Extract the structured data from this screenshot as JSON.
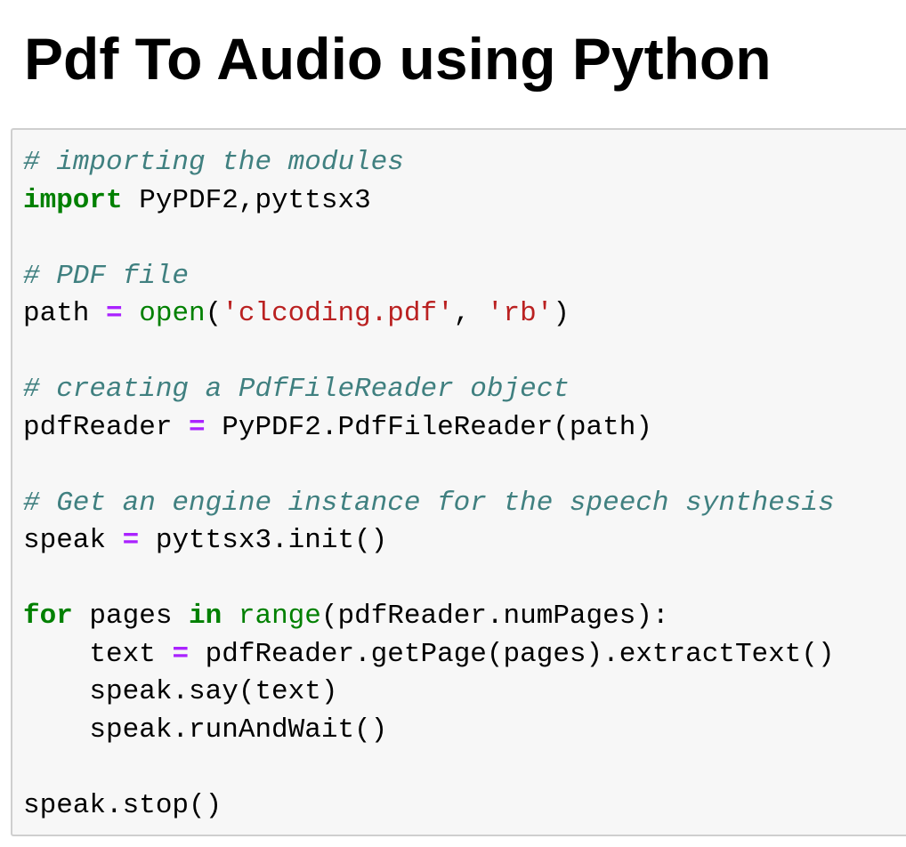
{
  "page": {
    "title": "Pdf To Audio using Python"
  },
  "colors": {
    "comment": "#408080",
    "keyword": "#008000",
    "builtin": "#008000",
    "operator": "#aa22ff",
    "string": "#ba2121",
    "text": "#000000",
    "cell_background": "#f7f7f7",
    "cell_border": "#cfcfcf"
  },
  "code": {
    "language": "python",
    "lines": [
      [
        {
          "type": "comment",
          "text": "# importing the modules"
        }
      ],
      [
        {
          "type": "keyword",
          "text": "import"
        },
        {
          "type": "plain",
          "text": " PyPDF2,pyttsx3"
        }
      ],
      [],
      [
        {
          "type": "comment",
          "text": "# PDF file"
        }
      ],
      [
        {
          "type": "plain",
          "text": "path "
        },
        {
          "type": "operator",
          "text": "="
        },
        {
          "type": "plain",
          "text": " "
        },
        {
          "type": "builtin",
          "text": "open"
        },
        {
          "type": "plain",
          "text": "("
        },
        {
          "type": "string",
          "text": "'clcoding.pdf'"
        },
        {
          "type": "plain",
          "text": ", "
        },
        {
          "type": "string",
          "text": "'rb'"
        },
        {
          "type": "plain",
          "text": ")"
        }
      ],
      [],
      [
        {
          "type": "comment",
          "text": "# creating a PdfFileReader object"
        }
      ],
      [
        {
          "type": "plain",
          "text": "pdfReader "
        },
        {
          "type": "operator",
          "text": "="
        },
        {
          "type": "plain",
          "text": " PyPDF2.PdfFileReader(path)"
        }
      ],
      [],
      [
        {
          "type": "comment",
          "text": "# Get an engine instance for the speech synthesis"
        }
      ],
      [
        {
          "type": "plain",
          "text": "speak "
        },
        {
          "type": "operator",
          "text": "="
        },
        {
          "type": "plain",
          "text": " pyttsx3.init()"
        }
      ],
      [],
      [
        {
          "type": "keyword",
          "text": "for"
        },
        {
          "type": "plain",
          "text": " pages "
        },
        {
          "type": "keyword",
          "text": "in"
        },
        {
          "type": "plain",
          "text": " "
        },
        {
          "type": "builtin",
          "text": "range"
        },
        {
          "type": "plain",
          "text": "(pdfReader.numPages):"
        }
      ],
      [
        {
          "type": "plain",
          "text": "    text "
        },
        {
          "type": "operator",
          "text": "="
        },
        {
          "type": "plain",
          "text": " pdfReader.getPage(pages).extractText()"
        }
      ],
      [
        {
          "type": "plain",
          "text": "    speak.say(text)"
        }
      ],
      [
        {
          "type": "plain",
          "text": "    speak.runAndWait()"
        }
      ],
      [],
      [
        {
          "type": "plain",
          "text": "speak.stop()"
        }
      ]
    ]
  }
}
